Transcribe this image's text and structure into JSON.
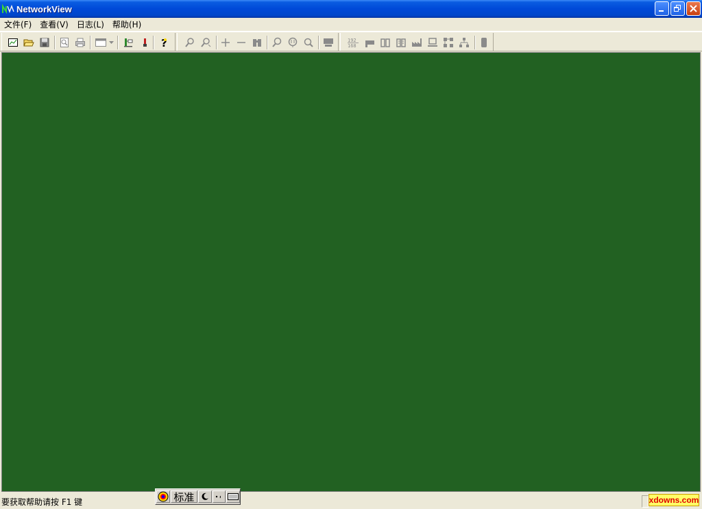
{
  "window": {
    "title": "NetworkView",
    "controls": [
      "minimize",
      "restore",
      "close"
    ]
  },
  "menubar": {
    "items": [
      {
        "label": "文件(F)"
      },
      {
        "label": "查看(V)"
      },
      {
        "label": "日志(L)"
      },
      {
        "label": "帮助(H)"
      }
    ]
  },
  "toolbar": {
    "icons": [
      "new-map-icon",
      "open-folder-icon",
      "save-icon",
      "print-preview-icon",
      "print-icon",
      "window-layout-icon",
      "dropdown-arrow-icon",
      "network-node-icon",
      "discover-icon",
      "help-icon",
      "zoom-in-icon",
      "zoom-out-icon",
      "add-icon",
      "remove-icon",
      "binoculars-icon",
      "search-icon",
      "ping-icon",
      "zoom-fit-icon",
      "server-icon",
      "ip-address-icon",
      "host-icon",
      "book-icon",
      "book-edit-icon",
      "factory-icon",
      "computer-icon",
      "topology-icon",
      "network-tree-icon",
      "device-icon"
    ],
    "ip_label_top": "192",
    "ip_label_bottom": "168"
  },
  "canvas": {
    "background": "#226122"
  },
  "status": {
    "help_text": "要获取帮助请按 F1 键"
  },
  "ime": {
    "mode": "标准"
  },
  "watermark": {
    "text": "xdowns.com"
  }
}
